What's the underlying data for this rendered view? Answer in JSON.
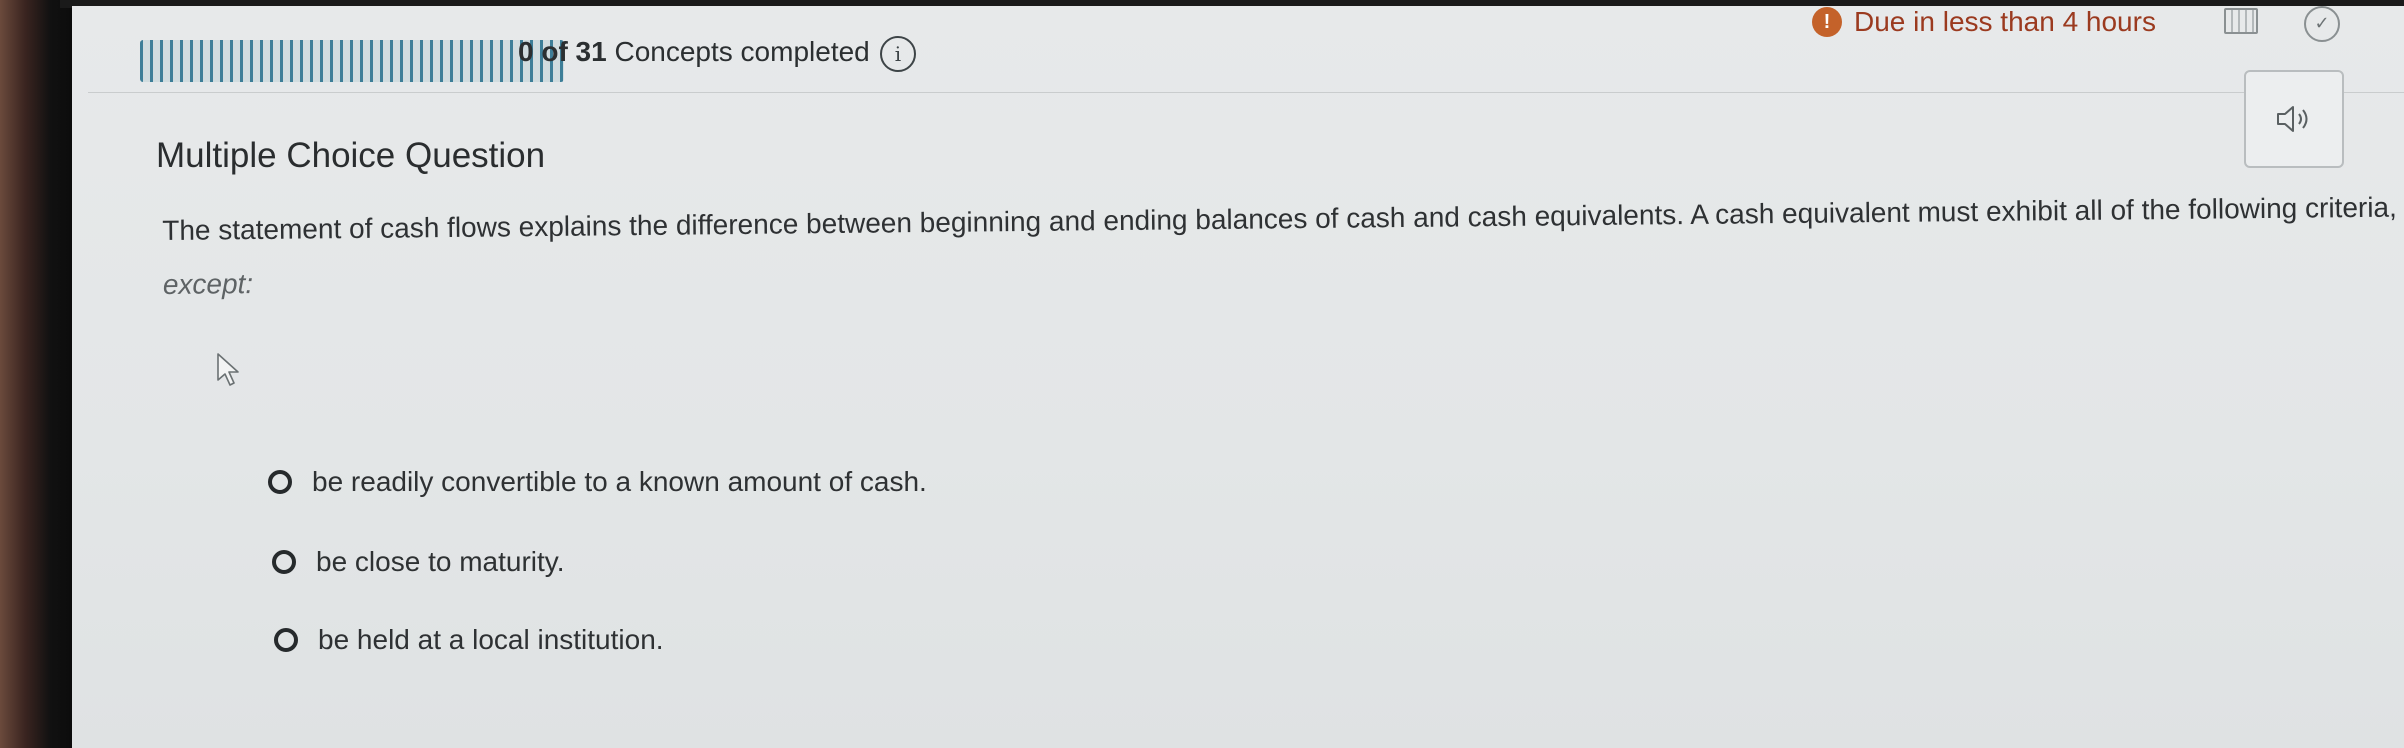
{
  "header": {
    "progress_count": "0 of 31",
    "progress_suffix": "Concepts completed",
    "progress_fraction": 0,
    "info_icon": "info-icon",
    "due_text": "Due in less than 4 hours",
    "due_icon": "alert-icon",
    "due_color": "#9b3a1f"
  },
  "question": {
    "type": "Multiple Choice Question",
    "prompt_main": "The statement of cash flows explains the difference between beginning and ending balances of cash and cash equivalents. A cash equivalent must exhibit all of the following criteria,",
    "prompt_emphasis": "except:",
    "audio_icon": "speaker-icon",
    "options": [
      {
        "label": "be readily convertible to a known amount of cash."
      },
      {
        "label": "be close to maturity."
      },
      {
        "label": "be held at a local institution."
      }
    ]
  },
  "colors": {
    "progress_bar": "#1f6b8a",
    "screen_bg": "#e7e9ea"
  }
}
